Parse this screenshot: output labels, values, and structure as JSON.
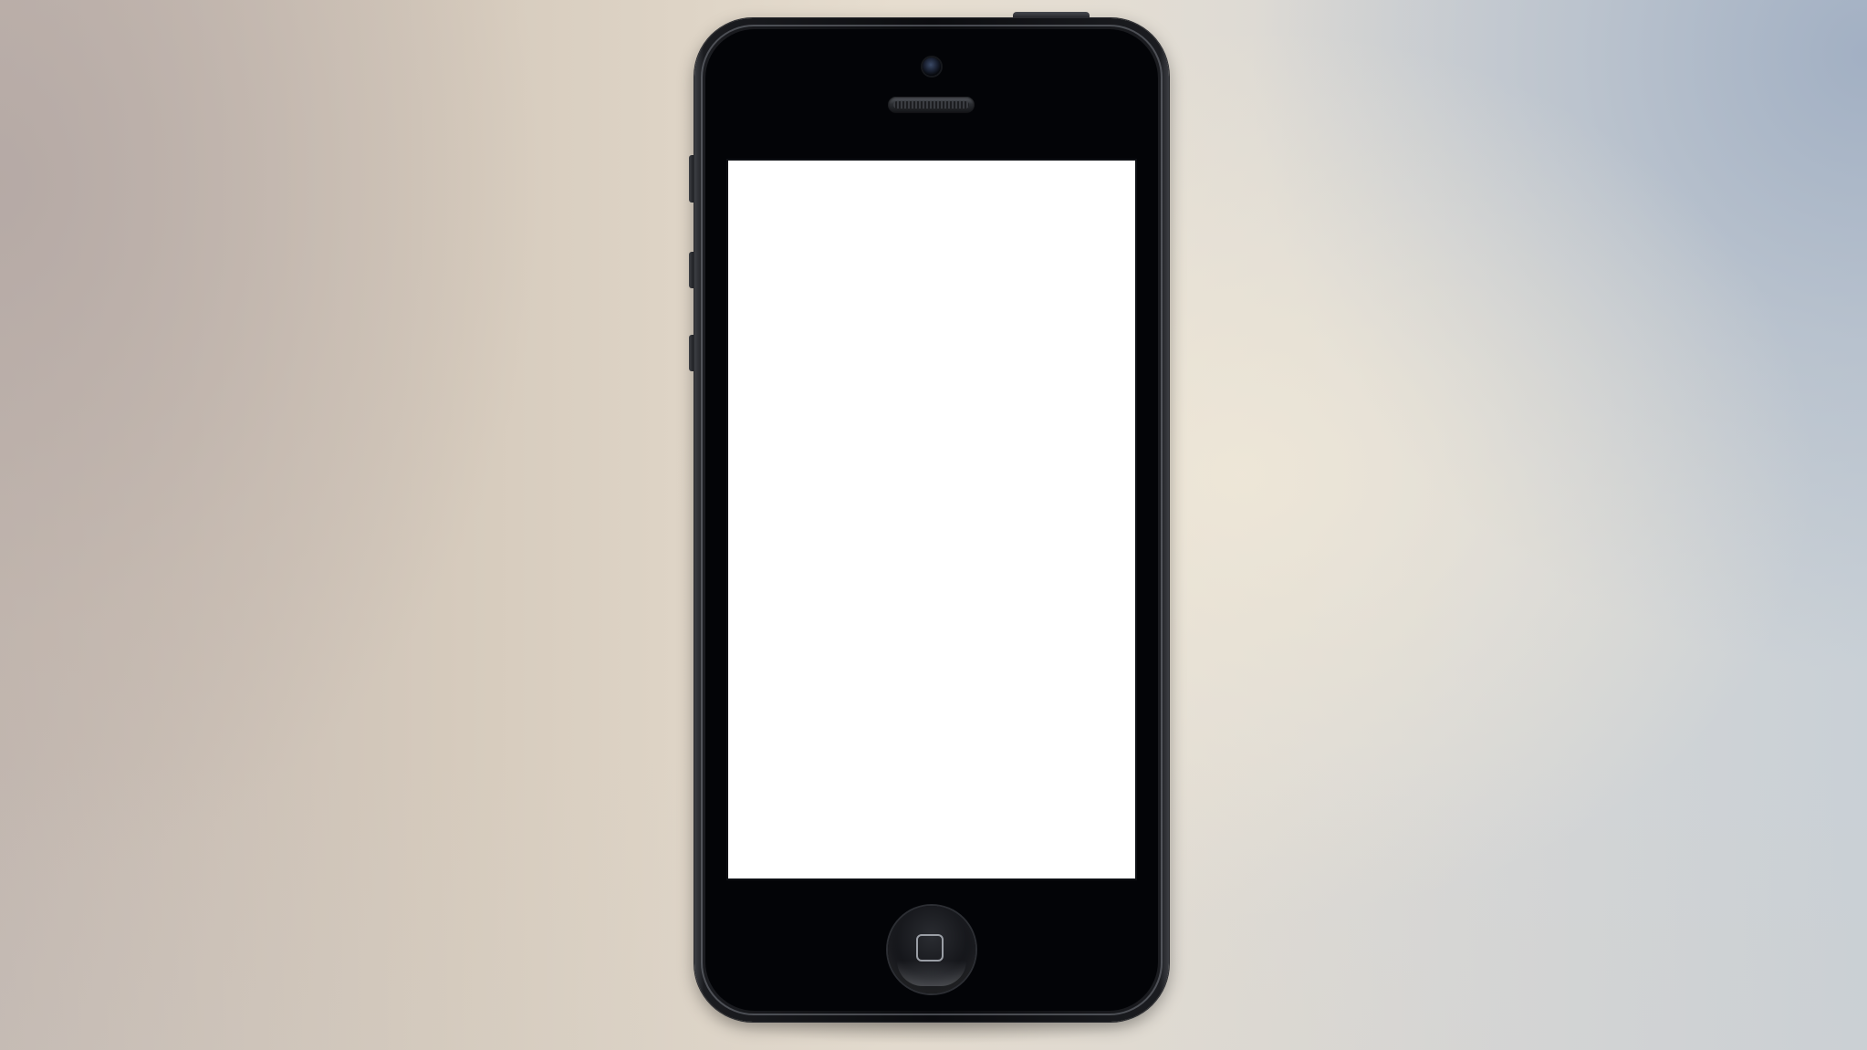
{
  "background": {
    "colors": [
      "#c2b7b0",
      "#e6ddcf",
      "#c9d0d6"
    ]
  },
  "device": {
    "type": "smartphone",
    "body_color": "#0b0c0f",
    "screen_color": "#ffffff",
    "icons": {
      "camera": "front-camera-icon",
      "speaker": "earpiece-speaker-icon",
      "home": "home-button-icon"
    }
  }
}
